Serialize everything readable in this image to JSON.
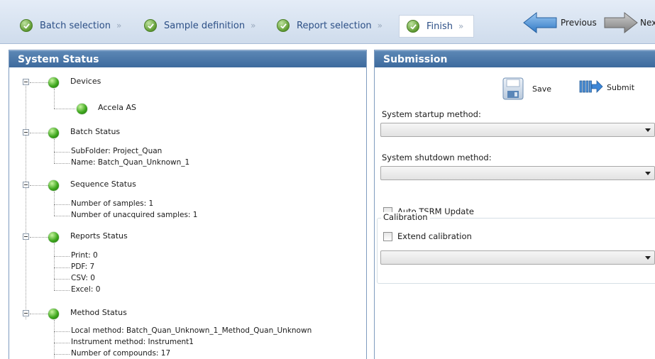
{
  "wizard": {
    "steps": [
      {
        "label": "Batch selection"
      },
      {
        "label": "Sample definition"
      },
      {
        "label": "Report selection"
      },
      {
        "label": "Finish"
      }
    ],
    "previous_label": "Previous",
    "next_label": "Nex"
  },
  "system_status": {
    "title": "System Status",
    "groups": [
      {
        "label": "Devices",
        "children": [
          "Accela AS"
        ]
      },
      {
        "label": "Batch Status",
        "children": [
          "SubFolder:  Project_Quan",
          "Name: Batch_Quan_Unknown_1"
        ]
      },
      {
        "label": "Sequence Status",
        "children": [
          "Number of samples: 1",
          "Number of unacquired samples: 1"
        ]
      },
      {
        "label": "Reports Status",
        "children": [
          "Print: 0",
          "PDF: 7",
          "CSV: 0",
          "Excel: 0"
        ]
      },
      {
        "label": "Method Status",
        "children": [
          "Local method: Batch_Quan_Unknown_1_Method_Quan_Unknown",
          "Instrument method: Instrument1",
          "Number of compounds: 17"
        ]
      }
    ]
  },
  "submission": {
    "title": "Submission",
    "save_label": "Save",
    "submit_label": "Submit",
    "startup_label": "System startup method:",
    "startup_value": "",
    "shutdown_label": "System shutdown method:",
    "shutdown_value": "",
    "auto_tsrm_label": "Auto TSRM Update",
    "calibration_title": "Calibration",
    "extend_calibration_label": "Extend calibration",
    "calibration_value": ""
  }
}
